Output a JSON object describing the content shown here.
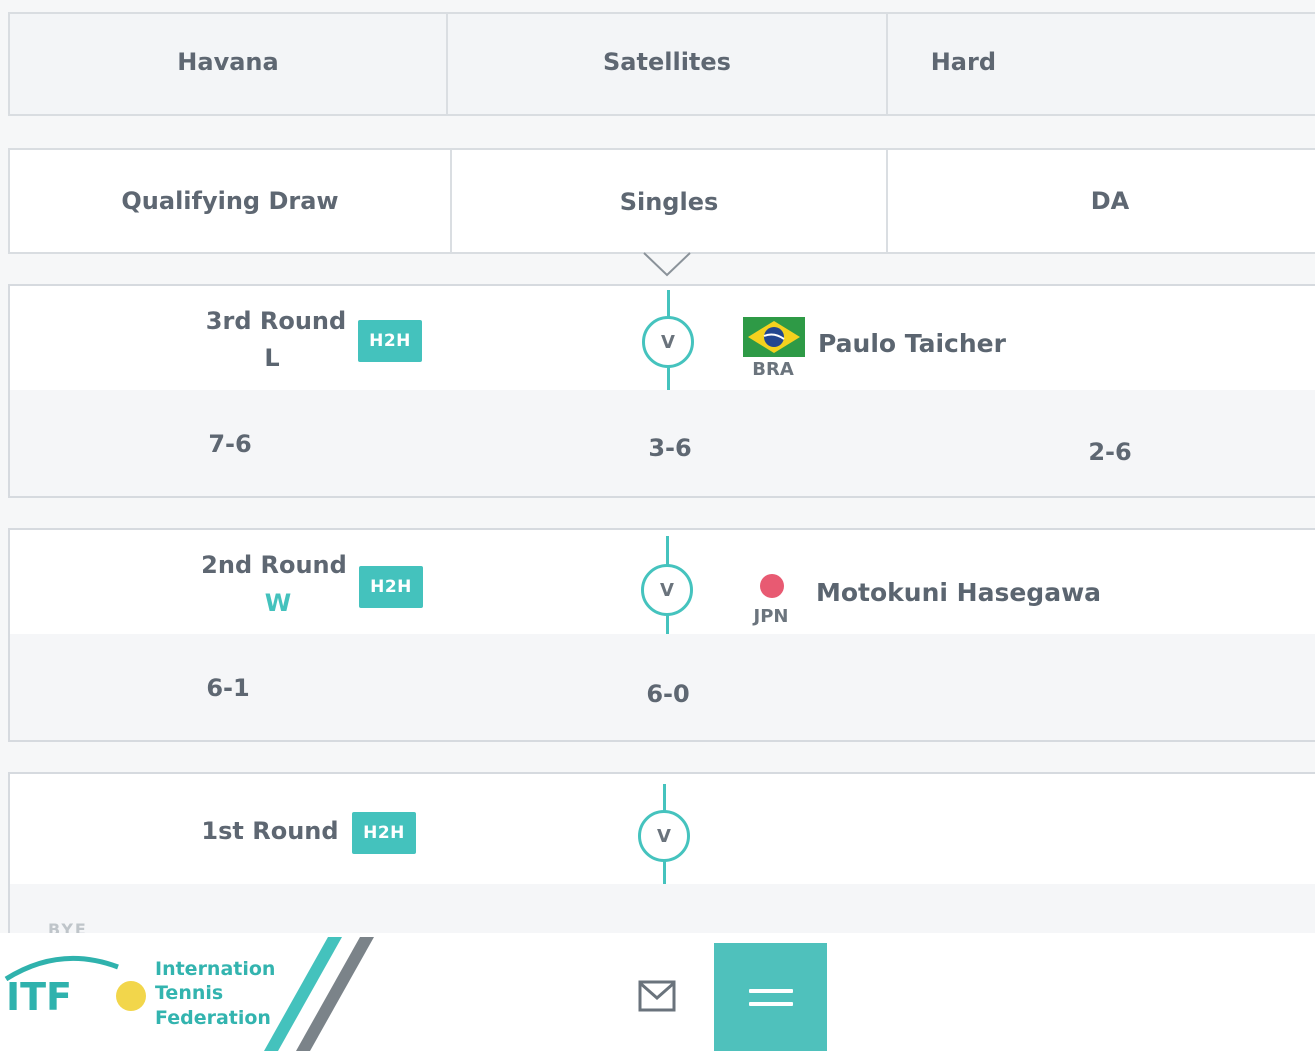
{
  "tournament_info": {
    "city": "Havana",
    "category": "Satellites",
    "surface": "Hard"
  },
  "draw_info": {
    "draw": "Qualifying Draw",
    "event": "Singles",
    "entry": "DA"
  },
  "matches": [
    {
      "round": "3rd Round",
      "result": "L",
      "result_color": "#5e6772",
      "h2h_label": "H2H",
      "vs_label": "V",
      "opponent": {
        "name": "Paulo Taicher",
        "country": "BRA",
        "flag_icon": "brazil-flag-icon"
      },
      "scores": [
        "7-6",
        "3-6",
        "2-6"
      ]
    },
    {
      "round": "2nd Round",
      "result": "W",
      "result_color": "#44c2bd",
      "h2h_label": "H2H",
      "vs_label": "V",
      "opponent": {
        "name": "Motokuni Hasegawa",
        "country": "JPN",
        "flag_icon": "japan-flag-icon"
      },
      "scores": [
        "6-1",
        "6-0"
      ]
    },
    {
      "round": "1st Round",
      "h2h_label": "H2H",
      "vs_label": "V"
    }
  ],
  "partial_text": "BYE",
  "footer": {
    "logo_text": "ITF",
    "org_line1": "Internation",
    "org_line2": "Tennis",
    "org_line3": "Federation",
    "mail_icon": "mail-icon",
    "menu_icon": "hamburger-menu-icon"
  },
  "colors": {
    "accent": "#44c2bd",
    "text": "#5e6772"
  }
}
